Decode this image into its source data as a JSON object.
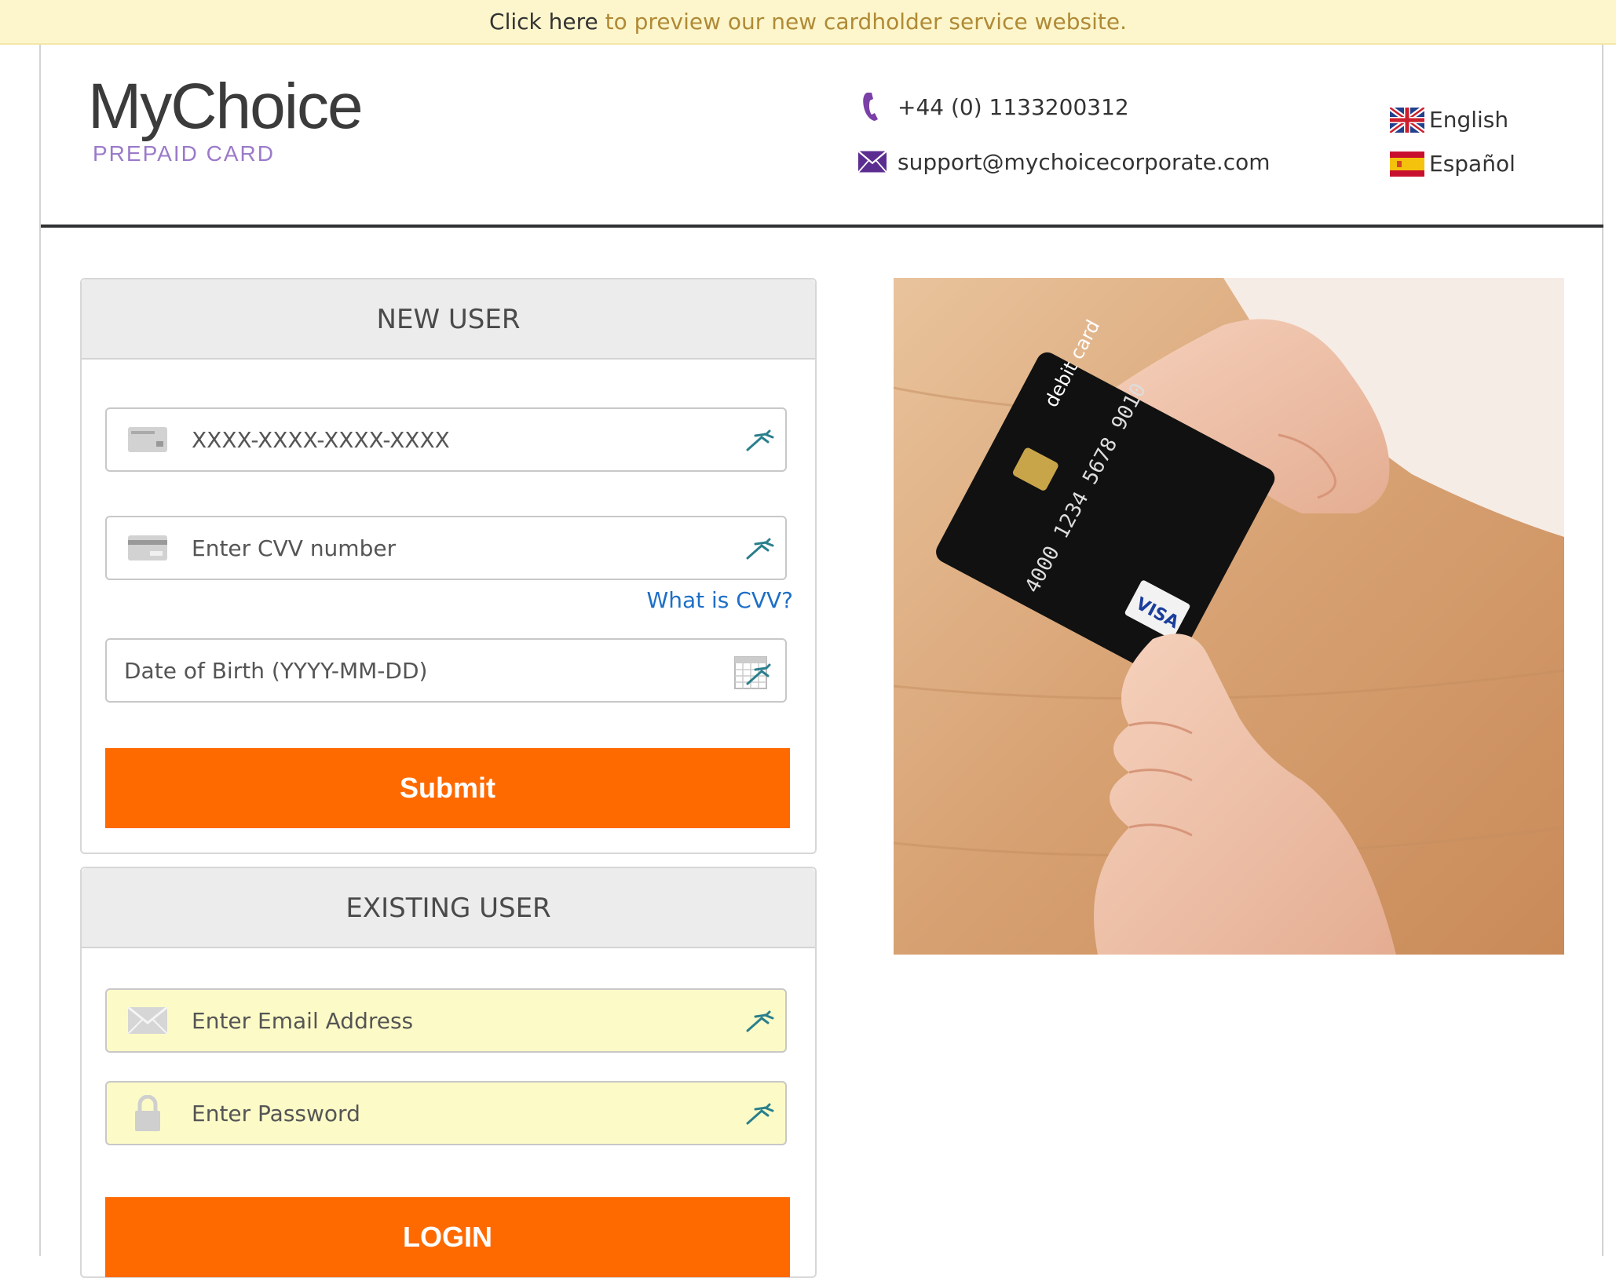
{
  "banner": {
    "link_text": "Click here",
    "rest_text": " to preview our new cardholder service website."
  },
  "logo": {
    "main": "MyChoice",
    "sub": "PREPAID CARD"
  },
  "contact": {
    "phone": "+44 (0) 1133200312",
    "email": "support@mychoicecorporate.com"
  },
  "languages": [
    {
      "label": "English",
      "flag": "uk-flag-icon"
    },
    {
      "label": "Español",
      "flag": "spain-flag-icon"
    }
  ],
  "new_user": {
    "title": "NEW USER",
    "card_placeholder": "XXXX-XXXX-XXXX-XXXX",
    "cvv_placeholder": "Enter CVV number",
    "cvv_help": "What is CVV?",
    "dob_placeholder": "Date of Birth (YYYY-MM-DD)",
    "submit_label": "Submit"
  },
  "existing_user": {
    "title": "EXISTING USER",
    "email_placeholder": "Enter Email Address",
    "password_placeholder": "Enter Password",
    "login_label": "LOGIN"
  },
  "colors": {
    "accent": "#ff6a00",
    "banner_bg": "#fdf6cc",
    "banner_link": "#b08a36",
    "brand_purple": "#9b7ac9",
    "link_blue": "#1e6fc7",
    "autofill_yellow": "#fcfbc7"
  },
  "photo": {
    "card_text": "debit card",
    "card_number": "4000 1234 5678 9010",
    "card_brand": "VISA"
  }
}
